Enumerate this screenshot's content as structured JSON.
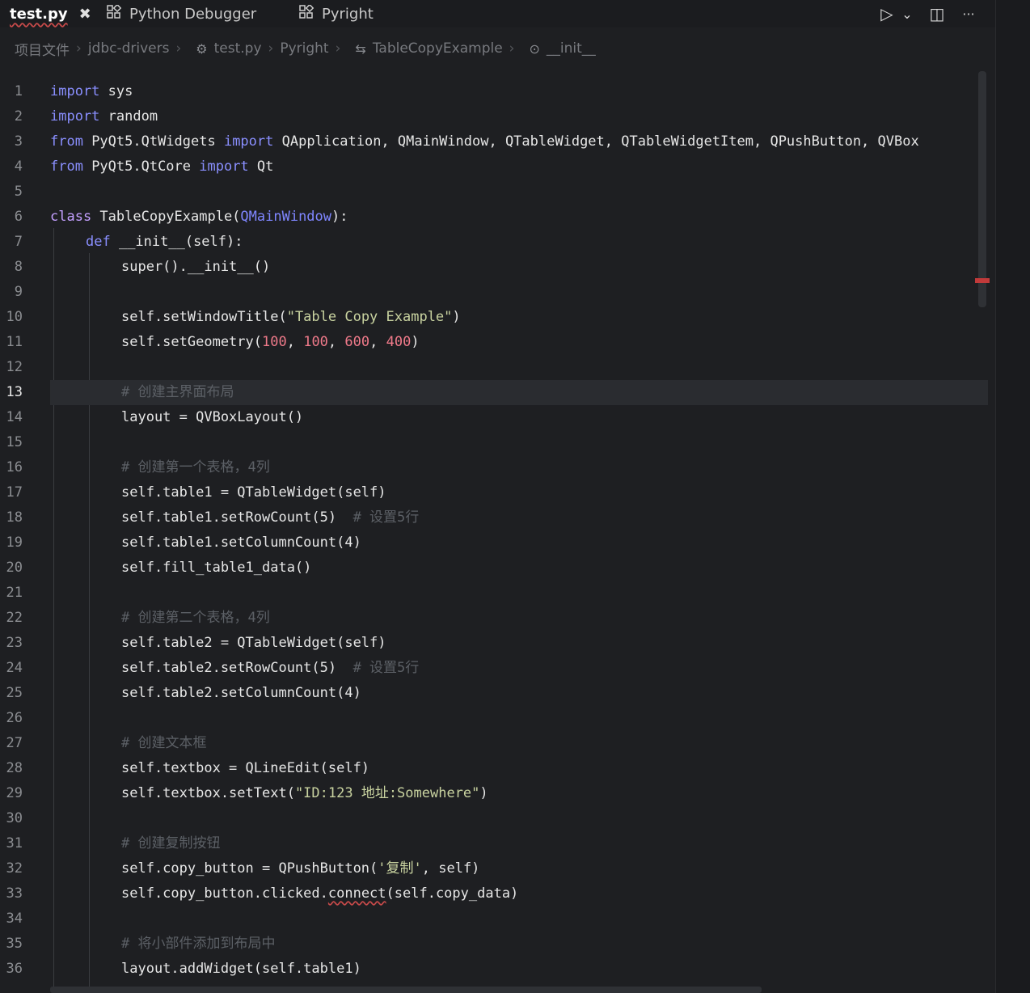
{
  "tabs": [
    {
      "label": "test.py",
      "active": true,
      "close_glyph": "✖"
    },
    {
      "label": "Python Debugger",
      "icon": "extensions-icon"
    },
    {
      "label": "Pyright",
      "icon": "extensions-icon"
    }
  ],
  "toolbar": {
    "run_glyph": "▷",
    "run_dropdown_glyph": "⌄",
    "split_glyph": "◫",
    "more_glyph": "···"
  },
  "breadcrumb": {
    "items": [
      "项目文件",
      "jdbc-drivers",
      "test.py",
      "Pyright",
      "TableCopyExample",
      "__init__"
    ],
    "separator": "›"
  },
  "editor": {
    "current_line": 13,
    "lines": [
      {
        "n": "1"
      },
      {
        "n": "2"
      },
      {
        "n": "3"
      },
      {
        "n": "4"
      },
      {
        "n": "5"
      },
      {
        "n": "6"
      },
      {
        "n": "7"
      },
      {
        "n": "8"
      },
      {
        "n": "9"
      },
      {
        "n": "10"
      },
      {
        "n": "11"
      },
      {
        "n": "12"
      },
      {
        "n": "13"
      },
      {
        "n": "14"
      },
      {
        "n": "15"
      },
      {
        "n": "16"
      },
      {
        "n": "17"
      },
      {
        "n": "18"
      },
      {
        "n": "19"
      },
      {
        "n": "20"
      },
      {
        "n": "21"
      },
      {
        "n": "22"
      },
      {
        "n": "23"
      },
      {
        "n": "24"
      },
      {
        "n": "25"
      },
      {
        "n": "26"
      },
      {
        "n": "27"
      },
      {
        "n": "28"
      },
      {
        "n": "29"
      },
      {
        "n": "30"
      },
      {
        "n": "31"
      },
      {
        "n": "32"
      },
      {
        "n": "33"
      },
      {
        "n": "34"
      },
      {
        "n": "35"
      },
      {
        "n": "36"
      }
    ],
    "code": {
      "l1": [
        "import",
        " sys"
      ],
      "l2": [
        "import",
        " random"
      ],
      "l3": [
        "from",
        " PyQt5.QtWidgets ",
        "import",
        " QApplication, QMainWindow, QTableWidget, QTableWidgetItem, QPushButton, QVBox"
      ],
      "l4": [
        "from",
        " PyQt5.QtCore ",
        "import",
        " Qt"
      ],
      "l6": [
        "class",
        " TableCopyExample(",
        "QMainWindow",
        "):"
      ],
      "l7": [
        "def",
        " __init__(self):"
      ],
      "l8": [
        "super().__init__()"
      ],
      "l10": [
        "self.setWindowTitle(",
        "\"Table Copy Example\"",
        ")"
      ],
      "l11": [
        "self.setGeometry(",
        "100",
        ", ",
        "100",
        ", ",
        "600",
        ", ",
        "400",
        ")"
      ],
      "l13": [
        "# 创建主界面布局"
      ],
      "l14": [
        "layout = QVBoxLayout()"
      ],
      "l16": [
        "# 创建第一个表格，4列"
      ],
      "l17": [
        "self.table1 = QTableWidget(self)"
      ],
      "l18": [
        "self.table1.setRowCount(5)",
        "  # 设置5行"
      ],
      "l19": [
        "self.table1.setColumnCount(4)"
      ],
      "l20": [
        "self.fill_table1_data()"
      ],
      "l22": [
        "# 创建第二个表格，4列"
      ],
      "l23": [
        "self.table2 = QTableWidget(self)"
      ],
      "l24": [
        "self.table2.setRowCount(5)",
        "  # 设置5行"
      ],
      "l25": [
        "self.table2.setColumnCount(4)"
      ],
      "l27": [
        "# 创建文本框"
      ],
      "l28": [
        "self.textbox = QLineEdit(self)"
      ],
      "l29": [
        "self.textbox.setText(",
        "\"ID:123 地址:Somewhere\"",
        ")"
      ],
      "l31": [
        "# 创建复制按钮"
      ],
      "l32": [
        "self.copy_button = QPushButton(",
        "'复制'",
        ", self)"
      ],
      "l33": [
        "self.copy_button.clicked.",
        "connect",
        "(self.copy_data)"
      ],
      "l35": [
        "# 将小部件添加到布局中"
      ],
      "l36": [
        "layout.addWidget(self.table1)"
      ]
    }
  }
}
